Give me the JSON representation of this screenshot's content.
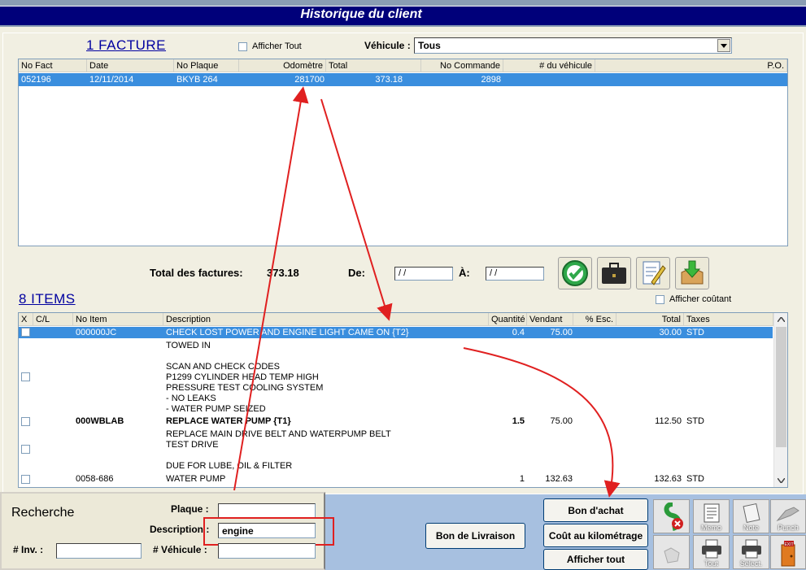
{
  "window": {
    "title": "Historique du client"
  },
  "facture": {
    "section_title": "1  FACTURE",
    "afficher_tout_label": "Afficher Tout",
    "vehicule_label": "Véhicule :",
    "vehicule_value": "Tous",
    "columns": [
      "No Fact",
      "Date",
      "No Plaque",
      "Odomètre",
      "Total",
      "No Commande",
      "# du véhicule",
      "P.O."
    ],
    "rows": [
      {
        "no_fact": "052196",
        "date": "12/11/2014",
        "no_plaque": "BKYB 264",
        "odometre": "281700",
        "total": "373.18",
        "no_commande": "2898",
        "no_vehicule": "",
        "po": ""
      }
    ]
  },
  "totals": {
    "label": "Total des factures:",
    "value": "373.18",
    "de_label": "De:",
    "de_value": " / /",
    "a_label": "À:",
    "a_value": " / /"
  },
  "items": {
    "section_title": "8  ITEMS",
    "afficher_coutant_label": "Afficher coûtant",
    "columns": [
      "X",
      "C/L",
      "No Item",
      "Description",
      "Quantité",
      "Vendant",
      "% Esc.",
      "Total",
      "Taxes"
    ],
    "rows": [
      {
        "no_item": "000000JC",
        "description": "CHECK LOST POWER AND ENGINE LIGHT CAME ON {T2}",
        "quantite": "0.4",
        "vendant": "75.00",
        "esc": "",
        "total": "30.00",
        "taxes": "STD",
        "selected": true
      },
      {
        "no_item": "",
        "description": "TOWED IN"
      },
      {
        "no_item": "",
        "description": ""
      },
      {
        "no_item": "",
        "description": "SCAN AND CHECK CODES"
      },
      {
        "no_item": "",
        "description": "P1299 CYLINDER HEAD TEMP HIGH"
      },
      {
        "no_item": "",
        "description": "PRESSURE TEST COOLING SYSTEM"
      },
      {
        "no_item": "",
        "description": "- NO LEAKS"
      },
      {
        "no_item": "",
        "description": "- WATER PUMP SEIZED"
      },
      {
        "no_item": "000WBLAB",
        "description": "REPLACE WATER PUMP {T1}",
        "quantite": "1.5",
        "vendant": "75.00",
        "esc": "",
        "total": "112.50",
        "taxes": "STD",
        "bold": true
      },
      {
        "no_item": "",
        "description": "REPLACE MAIN DRIVE BELT AND WATERPUMP BELT"
      },
      {
        "no_item": "",
        "description": "TEST DRIVE"
      },
      {
        "no_item": "",
        "description": ""
      },
      {
        "no_item": "",
        "description": "DUE FOR LUBE, OIL & FILTER"
      },
      {
        "no_item": "0058-686",
        "description": "WATER PUMP",
        "quantite": "1",
        "vendant": "132.63",
        "esc": "",
        "total": "132.63",
        "taxes": "STD"
      }
    ]
  },
  "recherche": {
    "title": "Recherche",
    "plaque_label": "Plaque :",
    "plaque_value": "",
    "description_label": "Description :",
    "description_value": "engine",
    "inv_label": "# Inv.  :",
    "inv_value": "",
    "vehicule_label": "# Véhicule :",
    "vehicule_value": ""
  },
  "buttons": {
    "bon_livraison": "Bon de Livraison",
    "bon_achat": "Bon d'achat",
    "cout_km": "Coût au kilométrage",
    "afficher_tout": "Afficher tout",
    "memo": "Memo",
    "note": "Note",
    "punch": "Punch",
    "tout": "Tout",
    "select": "Sélect."
  }
}
